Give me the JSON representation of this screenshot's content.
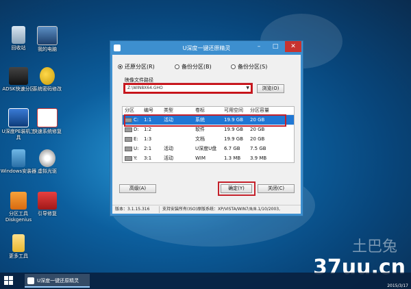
{
  "desktop": {
    "icons": [
      {
        "label": "回收站",
        "icon": "recycle-bin-icon"
      },
      {
        "label": "我的电脑",
        "icon": "computer-icon"
      },
      {
        "label": "ADSK快速分区",
        "icon": "partition-icon"
      },
      {
        "label": "系统密码修改",
        "icon": "key-icon"
      },
      {
        "label": "U深度PE装机工具",
        "icon": "installer-icon"
      },
      {
        "label": "快速系统修复",
        "icon": "repair-kit-icon"
      },
      {
        "label": "Windows安装器",
        "icon": "windows-installer-icon"
      },
      {
        "label": "虚拟光驱",
        "icon": "virtual-drive-icon"
      },
      {
        "label": "分区工具Diskgenius",
        "icon": "diskgenius-icon"
      },
      {
        "label": "引导修复",
        "icon": "boot-repair-icon"
      },
      {
        "label": "更多工具",
        "icon": "folder-icon"
      }
    ],
    "watermark": {
      "site": "37uu.cn",
      "brand": "土巴兔",
      "date": "2015/3/17"
    }
  },
  "window": {
    "title": "U深度一键还原精灵",
    "radios": [
      {
        "label": "还原分区(R)",
        "checked": true
      },
      {
        "label": "备份分区(B)",
        "checked": false
      },
      {
        "label": "备份分区(S)",
        "checked": false
      }
    ],
    "image_path_label": "映像文件路径",
    "image_path_value": "Z:\\WIN8X64.GHO",
    "browse_label": "浏览(O)",
    "table": {
      "columns": [
        "分区",
        "编号",
        "类型",
        "卷标",
        "可用空间",
        "分区容量"
      ],
      "rows": [
        [
          "C:",
          "1:1",
          "活动",
          "系统",
          "19.9 GB",
          "20 GB"
        ],
        [
          "D:",
          "1:2",
          "",
          "软件",
          "19.9 GB",
          "20 GB"
        ],
        [
          "E:",
          "1:3",
          "",
          "文档",
          "19.9 GB",
          "20 GB"
        ],
        [
          "U:",
          "2:1",
          "活动",
          "U深度U盘",
          "6.7 GB",
          "7.5 GB"
        ],
        [
          "Y:",
          "3:1",
          "活动",
          "WIM",
          "1.3 MB",
          "3.9 MB"
        ]
      ],
      "selected_row": 0
    },
    "advanced_label": "高级(A)",
    "confirm_label": "确定(Y)",
    "close_label": "关闭(C)",
    "version": "版本：3.1.15.316",
    "support": "支持安装所有(ISO)原版系统：XP/VISTA/WIN7/8/8.1/10/2003,"
  },
  "taskbar": {
    "active_task": "U深度一键还原精灵"
  }
}
